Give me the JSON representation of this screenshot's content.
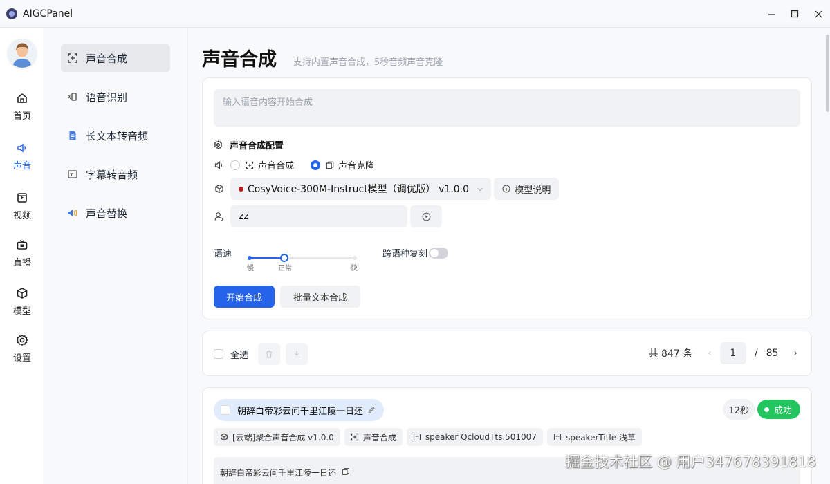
{
  "window": {
    "title": "AIGCPanel",
    "controls": [
      "minimize-icon",
      "maximize-icon",
      "close-icon"
    ]
  },
  "rail": {
    "items": [
      {
        "label": "首页",
        "icon": "home-icon"
      },
      {
        "label": "声音",
        "icon": "sound-icon"
      },
      {
        "label": "视频",
        "icon": "video-icon"
      },
      {
        "label": "直播",
        "icon": "live-icon"
      },
      {
        "label": "模型",
        "icon": "cube-icon"
      },
      {
        "label": "设置",
        "icon": "gear-icon"
      }
    ],
    "active": "声音"
  },
  "subnav": {
    "items": [
      {
        "label": "声音合成",
        "icon": "scan-icon"
      },
      {
        "label": "语音识别",
        "icon": "voice-icon"
      },
      {
        "label": "长文本转音频",
        "icon": "doc-icon"
      },
      {
        "label": "字幕转音频",
        "icon": "subtitle-icon"
      },
      {
        "label": "声音替换",
        "icon": "speaker-swap-icon"
      }
    ],
    "active": "声音合成"
  },
  "page": {
    "title": "声音合成",
    "subtitle": "支持内置声音合成，5秒音频声音克隆"
  },
  "composer": {
    "input_placeholder": "输入语音内容开始合成",
    "config_title": "声音合成配置",
    "mode_options": [
      "声音合成",
      "声音克隆"
    ],
    "mode_selected": "声音克隆",
    "model_select": "CosyVoice-300M-Instruct模型（调优版） v1.0.0",
    "model_info_button": "模型说明",
    "speaker_value": "zz",
    "speed_label": "语速",
    "speed_ticks": [
      "慢",
      "正常",
      "快"
    ],
    "speed_value": "正常",
    "cross_lang_label": "跨语种复刻",
    "cross_lang_on": false,
    "start_button": "开始合成",
    "batch_button": "批量文本合成"
  },
  "list_toolbar": {
    "select_all": "全选",
    "total_text": "共 847 条",
    "current_page": "1",
    "page_separator": "/",
    "total_pages": "85"
  },
  "record": {
    "title": "朝辞白帝彩云间千里江陵一日还",
    "duration": "12秒",
    "status": "成功",
    "tags": [
      "[云端]聚合声音合成 v1.0.0",
      "声音合成",
      "speaker QcloudTts.501007",
      "speakerTitle 浅草"
    ],
    "text": "朝辞白帝彩云间千里江陵一日还"
  },
  "watermark": "掘金技术社区 @ 用户347678391818",
  "colors": {
    "accent": "#2563eb",
    "success": "#22c55e",
    "model_dot": "#b91c1c"
  }
}
